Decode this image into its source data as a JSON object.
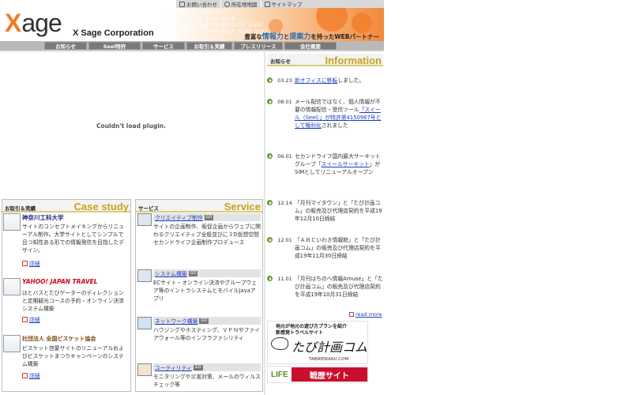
{
  "topbar": {
    "items": [
      {
        "label": "お問い合わせ",
        "icon": "mail-icon"
      },
      {
        "label": "所在地地図",
        "icon": "search-icon"
      },
      {
        "label": "サイトマップ",
        "icon": "sitemap-icon"
      }
    ]
  },
  "header": {
    "logo_x": "X",
    "logo_word": "age",
    "company": "X Sage Corporation",
    "tagline_pre": "豊富な",
    "tagline_hl1": "情報力",
    "tagline_mid": "と",
    "tagline_hl2": "提案力",
    "tagline_post": "を持ったWEBパートナー",
    "art_digits": "0x63 0x20 0x73\n  0x64 0x65 0x20\n0x41 0x67 0x65 0x20 0x64\n 0x53  0x6e 0x20 0x40 0x61"
  },
  "nav": {
    "items": [
      "お知らせ",
      "Seel特許",
      "サービス",
      "お取引＆実績",
      "プレスリリース",
      "会社概要"
    ]
  },
  "plugin": {
    "message": "Couldn't load plugin."
  },
  "info": {
    "jp": "お知らせ",
    "en": "Information",
    "news": [
      {
        "date": "03.23",
        "pre": "",
        "link": "新オフィスに移転",
        "post": "しました。"
      },
      {
        "date": "08.01",
        "pre": "メール配信ではなく、個人情報が不要の情報配信・受信ツール",
        "link": "「スイール（Seel）」が特許第4150967号として権利化",
        "post": "されました"
      },
      {
        "date": "06.01",
        "pre": "セカンドライフ国内最大サーキットグループ「",
        "link": "スイールサーキット",
        "post": "」がSIMとしてリニューアルオープン"
      },
      {
        "date": "12.14",
        "pre": "「月刊マイタウン」と「たび計画コム」の販売及び代理店契約を平成19年12月10日締結",
        "link": "",
        "post": ""
      },
      {
        "date": "12.01",
        "pre": "「ＡＢＣいわき情報館」と「たび計画コム」の販売及び代理店契約を平成19年11月30日締結",
        "link": "",
        "post": ""
      },
      {
        "date": "11.01",
        "pre": "「月刊はちのへ情報Amuse」と「たび計画コム」の販売及び代理店契約を平成19年10月31日締結",
        "link": "",
        "post": ""
      }
    ],
    "more": "read more"
  },
  "banners": {
    "b1_line1": "地元が地元の遊び方プランを紹介",
    "b1_line2": "新感覚トラベルサイト",
    "b1_script": "たび計画コム",
    "b1_url": "TABIKEIKAKU.COM",
    "b2_left": "LIFE",
    "b2_right": "戦歴サイト"
  },
  "case_panel": {
    "jp": "お取引＆実績",
    "en": "Case study",
    "items": [
      {
        "brand": "神奈川工科大学",
        "brand_color": "#1a237e",
        "desc": "サイトのコンセプトメイキングからリニューアル制作。大学サイトとしてシンプルで且つ知性ある形での情報発信を目指したデザイン。",
        "detail": "詳細"
      },
      {
        "brand": "YAHOO! JAPAN TRAVEL",
        "brand_color": "#d0021b",
        "desc": "はとバスとたびゲーターのディレクションと定期観光コースの予約・オンライン決済システム構築",
        "detail": "詳細"
      },
      {
        "brand": "社団法人 全国ビスケット協会",
        "brand_color": "#7a4a12",
        "desc": "ビスケット啓蒙サイトのリニューアルおよびビスケットまつりキャンペーンのシステム構築",
        "detail": "詳細"
      }
    ]
  },
  "service_panel": {
    "jp": "サービス",
    "en": "Service",
    "go": "GO",
    "items": [
      {
        "title": "クリエイティブ制作",
        "desc": "サイトの企画制作、販促企画からウェブに関わるクリエイティブ全般並びに３D仮想空間セカンドライフ企画制作プロデュース"
      },
      {
        "title": "システム構築",
        "desc": "ECサイト・オンライン決済やグループウェア等のイントラシステムとモバイルJavaアプリ"
      },
      {
        "title": "ネットワーク構築",
        "desc": "ハウジングやホスティング、ＶＰＮやファイアウォール等のインフラファシリティ"
      },
      {
        "title": "ユーティリティ",
        "desc": "モニタリングや災害対策、メールのウィルスチェック等"
      }
    ]
  },
  "colors": {
    "accent": "#f07c24",
    "nav_bg": "#7a7a7a",
    "heading_en": "#c9a31c",
    "link": "#1a3fbf"
  }
}
